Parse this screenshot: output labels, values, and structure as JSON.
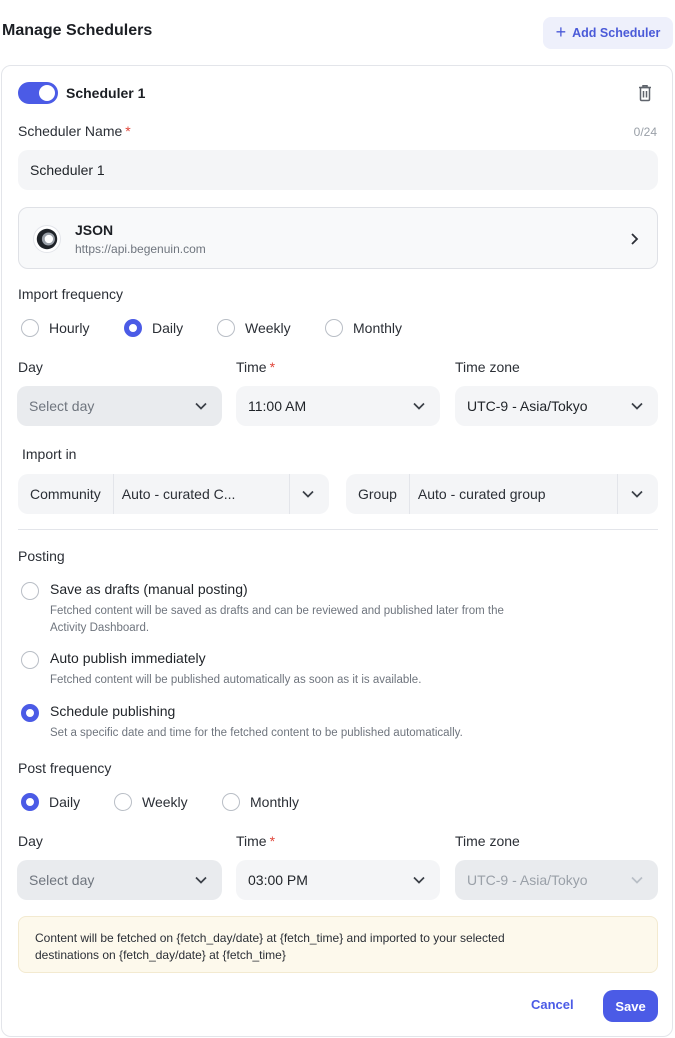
{
  "header": {
    "title": "Manage Schedulers",
    "add_button": "Add Scheduler"
  },
  "scheduler": {
    "enabled": true,
    "title": "Scheduler 1",
    "name_label": "Scheduler Name",
    "name_required": "*",
    "name_counter": "0/24",
    "name_value": "Scheduler 1",
    "source": {
      "name": "JSON",
      "url": "https://api.begenuin.com"
    }
  },
  "import_frequency": {
    "label": "Import frequency",
    "options": [
      "Hourly",
      "Daily",
      "Weekly",
      "Monthly"
    ],
    "selected": "Daily",
    "day_label": "Day",
    "day_placeholder": "Select day",
    "time_label": "Time",
    "time_required": "*",
    "time_value": "11:00 AM",
    "timezone_label": "Time zone",
    "timezone_value": "UTC-9 - Asia/Tokyo"
  },
  "import_in": {
    "label": "Import in",
    "community_label": "Community",
    "community_value": "Auto - curated C...",
    "group_label": "Group",
    "group_value": "Auto - curated group"
  },
  "posting": {
    "label": "Posting",
    "options": [
      {
        "title": "Save as drafts (manual posting)",
        "desc_line1": "Fetched content will be saved as drafts and can be reviewed and published later from the",
        "desc_line2": "Activity Dashboard."
      },
      {
        "title": "Auto publish immediately",
        "desc_line1": "Fetched content will be published automatically as soon as it is available."
      },
      {
        "title": "Schedule publishing",
        "desc_line1": "Set a specific date and time for the fetched content to be published automatically."
      }
    ],
    "selected": "Schedule publishing"
  },
  "post_frequency": {
    "label": "Post frequency",
    "options": [
      "Daily",
      "Weekly",
      "Monthly"
    ],
    "selected": "Daily",
    "day_label": "Day",
    "day_placeholder": "Select day",
    "time_label": "Time",
    "time_required": "*",
    "time_value": "03:00 PM",
    "timezone_label": "Time zone",
    "timezone_value": "UTC-9 - Asia/Tokyo"
  },
  "note": {
    "line1": "Content will be fetched on {fetch_day/date} at {fetch_time} and  imported to your selected",
    "line2": "destinations on {fetch_day/date} at {fetch_time}"
  },
  "actions": {
    "cancel": "Cancel",
    "save": "Save"
  },
  "colors": {
    "accent": "#4b5be6",
    "note_bg": "#fdf9ec",
    "required": "#e0463a"
  },
  "icons": [
    "plus-icon",
    "trash-icon",
    "json-logo",
    "chevron-right-icon",
    "chevron-down-icon"
  ]
}
